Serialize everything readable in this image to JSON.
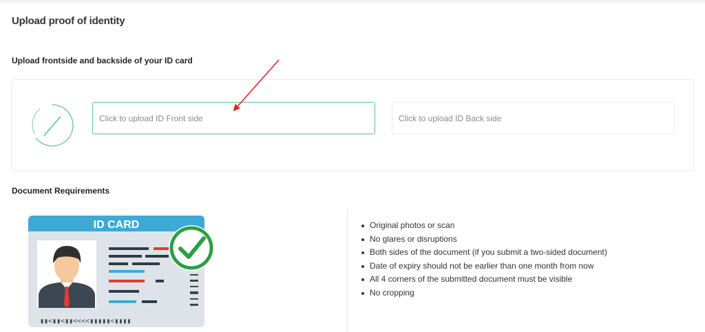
{
  "page": {
    "title": "Upload proof of identity"
  },
  "upload": {
    "heading": "Upload frontside and backside of your ID card",
    "front_placeholder": "Click to upload ID Front side",
    "back_placeholder": "Click to upload ID Back side",
    "spinner_icon": "loading-spinner-icon",
    "accent_color": "#5cc48a"
  },
  "requirements": {
    "heading": "Document Requirements",
    "illustration": {
      "header": "ID CARD",
      "footer": "▮▮<▮▮<▮▮<<<<▮▮▮▮▮<▮▮▮▮",
      "check_icon": "check-circle-icon",
      "header_color": "#3fa9d6"
    },
    "items": [
      "Original photos or scan",
      "No glares or disruptions",
      "Both sides of the document (if you submit a two-sided document)",
      "Date of expiry should not be earlier than one month from now",
      "All 4 corners of the submitted document must be visible",
      "No cropping"
    ]
  }
}
